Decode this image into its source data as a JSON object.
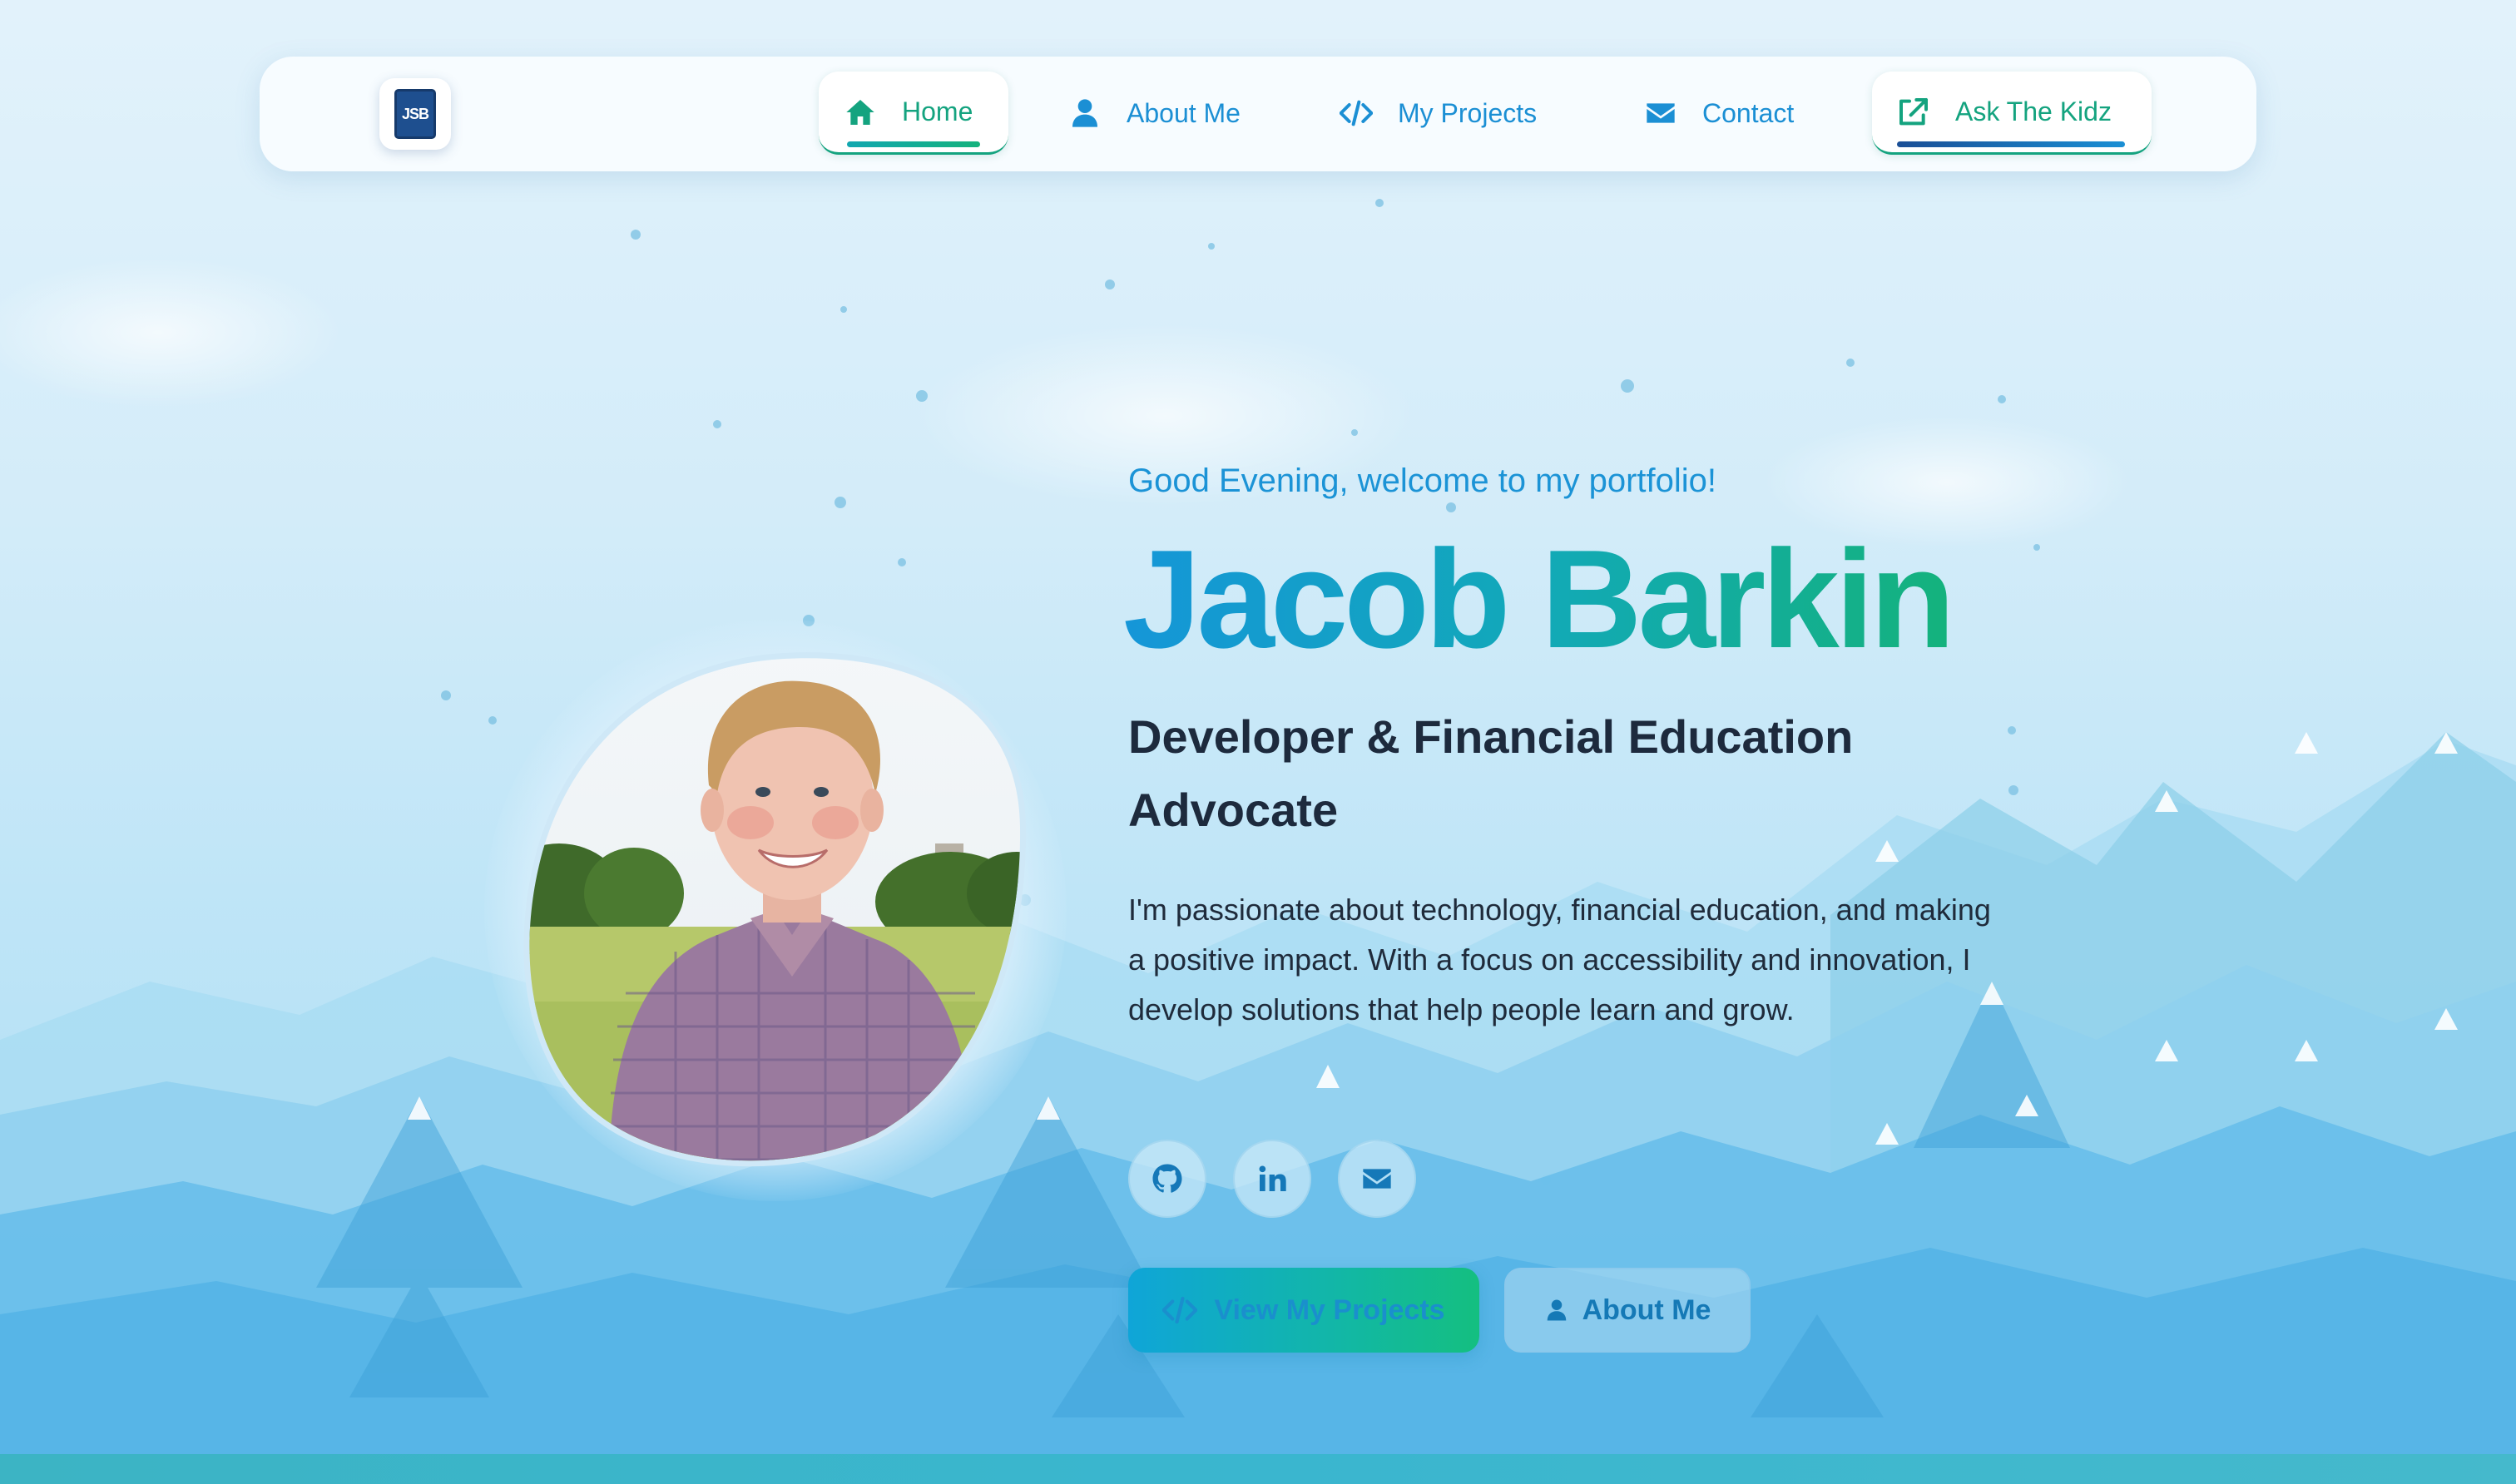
{
  "nav": {
    "logo_text": "JSB",
    "items": [
      {
        "label": "Home",
        "icon": "home-icon",
        "active": true
      },
      {
        "label": "About Me",
        "icon": "user-icon"
      },
      {
        "label": "My Projects",
        "icon": "code-icon"
      },
      {
        "label": "Contact",
        "icon": "envelope-icon"
      },
      {
        "label": "Ask The Kidz",
        "icon": "external-link-icon"
      }
    ]
  },
  "hero": {
    "greeting": "Good Evening, welcome to my portfolio!",
    "name": "Jacob Barkin",
    "role": "Developer & Financial Education Advocate",
    "bio": "I'm passionate about technology, financial education, and making a positive impact. With a focus on accessibility and innovation, I develop solutions that help people learn and grow.",
    "socials": [
      {
        "icon": "github-icon"
      },
      {
        "icon": "linkedin-icon"
      },
      {
        "icon": "envelope-icon"
      }
    ],
    "primary_cta": "View My Projects",
    "secondary_cta": "About Me"
  },
  "colors": {
    "accent_green": "#14a37f",
    "accent_blue": "#1b8fd4",
    "text_dark": "#1d2a3d"
  }
}
